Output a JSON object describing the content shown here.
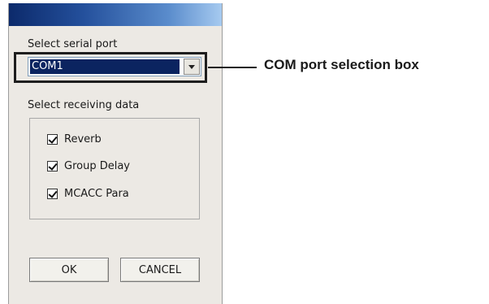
{
  "dialog": {
    "serial_port_label": "Select serial port",
    "com_port": {
      "selected": "COM1"
    },
    "receiving_label": "Select receiving data",
    "checkboxes": [
      {
        "label": "Reverb",
        "checked": true
      },
      {
        "label": "Group Delay",
        "checked": true
      },
      {
        "label": "MCACC Para",
        "checked": true
      }
    ],
    "ok_label": "OK",
    "cancel_label": "CANCEL"
  },
  "callout": {
    "text": "COM port selection box"
  }
}
